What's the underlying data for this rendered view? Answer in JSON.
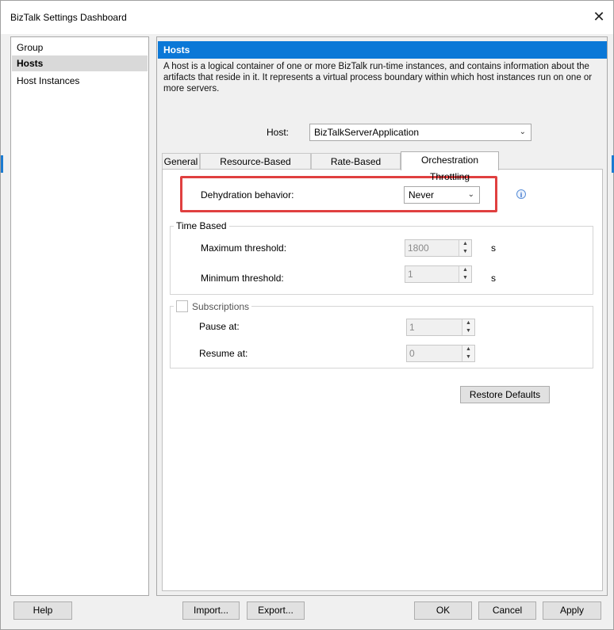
{
  "window": {
    "title": "BizTalk Settings Dashboard",
    "close_glyph": "✕"
  },
  "nav": {
    "items": [
      {
        "label": "Group",
        "selected": false
      },
      {
        "label": "Hosts",
        "selected": true
      },
      {
        "label": "Host Instances",
        "selected": false
      }
    ]
  },
  "content": {
    "header": "Hosts",
    "description": "A host is a logical container of one or more BizTalk run-time instances, and contains information about the artifacts that reside in it. It represents a virtual process boundary within which host instances run on one or more servers.",
    "host_label": "Host:",
    "host_value": "BizTalkServerApplication"
  },
  "tabs": [
    {
      "label": "General",
      "active": false
    },
    {
      "label": "Resource-Based Throttling",
      "active": false
    },
    {
      "label": "Rate-Based Throttling",
      "active": false
    },
    {
      "label": "Orchestration Throttling",
      "active": true
    }
  ],
  "orchestration": {
    "dehydration_label": "Dehydration behavior:",
    "dehydration_value": "Never",
    "info_icon": "info-icon",
    "time_based": {
      "legend": "Time Based",
      "max_label": "Maximum threshold:",
      "max_value": "1800",
      "max_unit": "s",
      "min_label": "Minimum threshold:",
      "min_value": "1",
      "min_unit": "s"
    },
    "subscriptions": {
      "legend": "Subscriptions",
      "checked": false,
      "pause_label": "Pause at:",
      "pause_value": "1",
      "resume_label": "Resume at:",
      "resume_value": "0"
    },
    "restore_label": "Restore Defaults"
  },
  "footer": {
    "help": "Help",
    "import": "Import...",
    "export": "Export...",
    "ok": "OK",
    "cancel": "Cancel",
    "apply": "Apply"
  },
  "colors": {
    "accent": "#0b78d7",
    "highlight": "#e04040"
  }
}
